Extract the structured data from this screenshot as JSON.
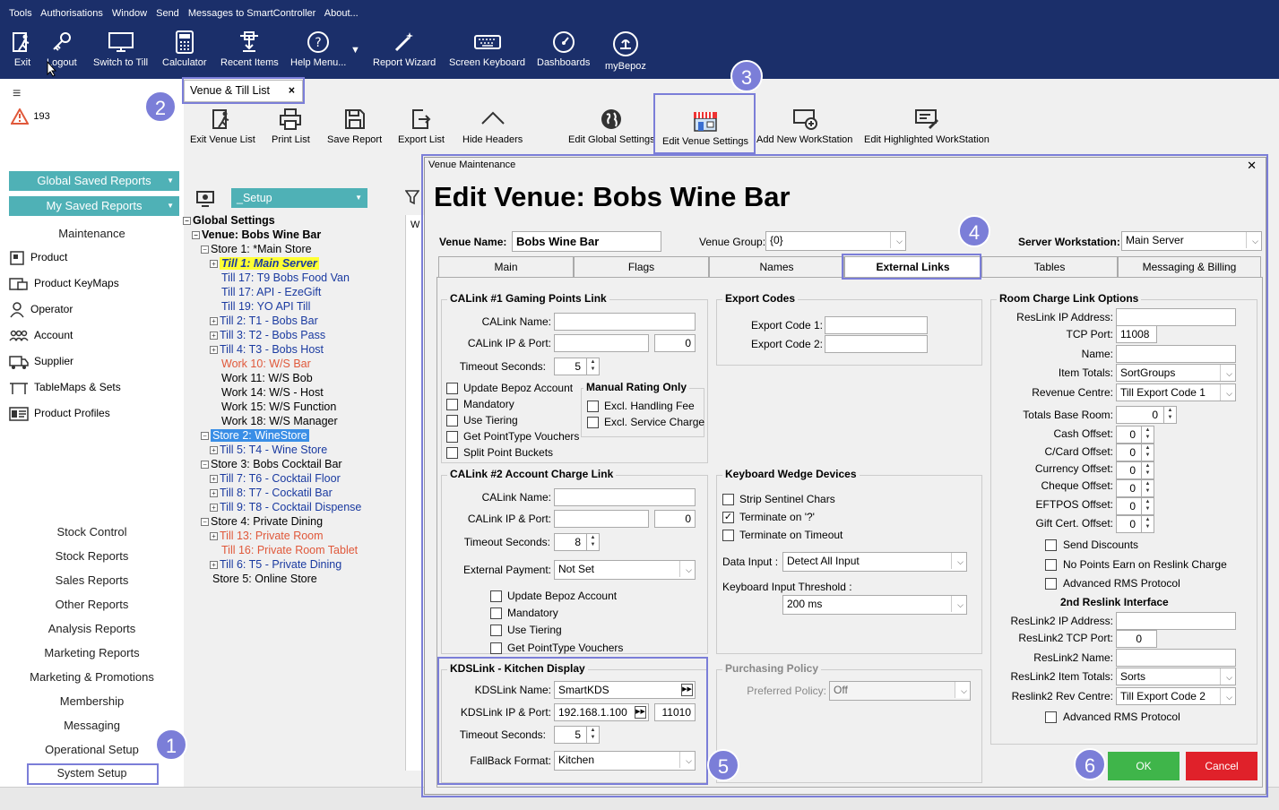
{
  "menu": [
    "Tools",
    "Authorisations",
    "Window",
    "Send",
    "Messages to SmartController",
    "About..."
  ],
  "toolbar": {
    "exit": "Exit",
    "logout": "Logout",
    "switch": "Switch to Till",
    "calculator": "Calculator",
    "recent": "Recent Items",
    "help": "Help Menu...",
    "wizard": "Report Wizard",
    "keyboard": "Screen Keyboard",
    "dashboards": "Dashboards",
    "mybepoz": "myBepoz"
  },
  "sidebar": {
    "alert_count": "193",
    "global_reports": "Global Saved Reports",
    "my_reports": "My Saved Reports",
    "maintenance": "Maintenance",
    "items": [
      "Product",
      "Product KeyMaps",
      "Operator",
      "Account",
      "Supplier",
      "TableMaps & Sets",
      "Product Profiles"
    ],
    "reports": [
      "Stock Control",
      "Stock Reports",
      "Sales Reports",
      "Other Reports",
      "Analysis Reports",
      "Marketing Reports",
      "Marketing & Promotions",
      "Membership",
      "Messaging",
      "Operational Setup",
      "System Setup"
    ]
  },
  "venue_tab": {
    "title": "Venue & Till List",
    "close": "×"
  },
  "venue_toolbar": {
    "exit": "Exit Venue List",
    "print": "Print List",
    "save": "Save Report",
    "export": "Export List",
    "hide": "Hide Headers",
    "global": "Edit Global Settings",
    "venue": "Edit Venue Settings",
    "add": "Add New WorkStation",
    "edit": "Edit Highlighted WorkStation"
  },
  "setup_select": "_Setup",
  "partial_text": "W",
  "tree": {
    "global": "Global Settings",
    "venue": "Venue: Bobs Wine Bar",
    "store1": "Store 1: *Main Store",
    "till1": "Till 1: Main Server",
    "till17a": "Till 17: T9 Bobs Food Van",
    "till17b": "Till 17: API - EzeGift",
    "till19": "Till 19: YO API Till",
    "till2": "Till 2: T1 - Bobs Bar",
    "till3": "Till 3: T2 - Bobs Pass",
    "till4": "Till 4: T3 - Bobs Host",
    "work10": "Work 10: W/S Bar",
    "work11": "Work 11: W/S Bob",
    "work14": "Work 14: W/S - Host",
    "work15": "Work 15: W/S Function",
    "work18": "Work 18: W/S Manager",
    "store2": "Store 2: WineStore",
    "till5": "Till 5: T4 - Wine Store",
    "store3": "Store 3: Bobs Cocktail Bar",
    "till7": "Till 7: T6 - Cocktail Floor",
    "till8": "Till 8: T7 - Cockatil Bar",
    "till9": "Till 9: T8 - Cocktail Dispense",
    "store4": "Store 4: Private Dining",
    "till13": "Till 13: Private Room",
    "till16": "Till 16: Private Room Tablet",
    "till6": "Till 6: T5 - Private Dining",
    "store5": "Store 5: Online Store"
  },
  "dialog": {
    "window_title": "Venue Maintenance",
    "close": "✕",
    "heading": "Edit Venue: Bobs Wine Bar",
    "venue_name_label": "Venue Name:",
    "venue_name": "Bobs Wine Bar",
    "venue_group_label": "Venue Group:",
    "venue_group": "{0}",
    "server_ws_label": "Server Workstation:",
    "server_ws": "Main Server",
    "tabs": [
      "Main",
      "Flags",
      "Names",
      "External Links",
      "Tables",
      "Messaging & Billing"
    ],
    "calink1": {
      "legend": "CALink #1 Gaming Points Link",
      "name_label": "CALink Name:",
      "ip_label": "CALink IP & Port:",
      "port": "0",
      "timeout_label": "Timeout Seconds:",
      "timeout": "5",
      "checks": [
        "Update Bepoz Account",
        "Mandatory",
        "Use Tiering",
        "Get PointType Vouchers",
        "Split Point Buckets"
      ],
      "manual_legend": "Manual Rating Only",
      "manual_checks": [
        "Excl. Handling Fee",
        "Excl. Service Charge"
      ]
    },
    "calink2": {
      "legend": "CALink #2 Account Charge Link",
      "name_label": "CALink Name:",
      "ip_label": "CALink IP & Port:",
      "port": "0",
      "timeout_label": "Timeout Seconds:",
      "timeout": "8",
      "ext_label": "External Payment:",
      "ext_value": "Not Set",
      "checks": [
        "Update Bepoz Account",
        "Mandatory",
        "Use Tiering",
        "Get PointType Vouchers"
      ]
    },
    "kds": {
      "legend": "KDSLink - Kitchen Display",
      "name_label": "KDSLink Name:",
      "name": "SmartKDS",
      "ip_label": "KDSLink IP & Port:",
      "ip": "192.168.1.100",
      "port": "11010",
      "timeout_label": "Timeout Seconds:",
      "timeout": "5",
      "fallback_label": "FallBack Format:",
      "fallback": "Kitchen"
    },
    "export": {
      "legend": "Export Codes",
      "code1": "Export Code 1:",
      "code2": "Export Code 2:"
    },
    "wedge": {
      "legend": "Keyboard Wedge Devices",
      "checks": [
        "Strip Sentinel Chars",
        "Terminate on '?'",
        "Terminate on Timeout"
      ],
      "data_input_label": "Data Input :",
      "data_input": "Detect All Input",
      "threshold_label": "Keyboard Input Threshold :",
      "threshold": "200 ms"
    },
    "purchasing": {
      "legend": "Purchasing Policy",
      "label": "Preferred Policy:",
      "value": "Off"
    },
    "room": {
      "legend": "Room Charge Link Options",
      "ip_label": "ResLink  IP Address:",
      "tcp_label": "TCP Port:",
      "tcp": "11008",
      "name_label": "Name:",
      "item_totals_label": "Item Totals:",
      "item_totals": "SortGroups",
      "revenue_label": "Revenue Centre:",
      "revenue": "Till Export Code 1",
      "totals_room_label": "Totals Base Room:",
      "offsets": [
        "Cash Offset:",
        "C/Card Offset:",
        "Currency Offset:",
        "Cheque Offset:",
        "EFTPOS Offset:",
        "Gift Cert. Offset:"
      ],
      "zero": "0",
      "checks": [
        "Send Discounts",
        "No Points Earn on Reslink Charge",
        "Advanced RMS Protocol"
      ],
      "second_header": "2nd Reslink Interface",
      "ip2_label": "ResLink2  IP Address:",
      "tcp2_label": "ResLink2 TCP Port:",
      "name2_label": "ResLink2 Name:",
      "item2_label": "ResLink2 Item Totals:",
      "item2": "Sorts",
      "rev2_label": "Reslink2 Rev Centre:",
      "rev2": "Till Export Code 2",
      "adv2": "Advanced RMS Protocol"
    },
    "ok": "OK",
    "cancel": "Cancel"
  },
  "callouts": [
    "1",
    "2",
    "3",
    "4",
    "5",
    "6"
  ],
  "colors": {
    "topbar": "#1b2f6a",
    "teal": "#4fb1b6",
    "callout": "#7b7ed8",
    "ok": "#3fb54a",
    "cancel": "#e0212a",
    "highlight": "#ffff33",
    "store_sel": "#3a8ee6"
  }
}
